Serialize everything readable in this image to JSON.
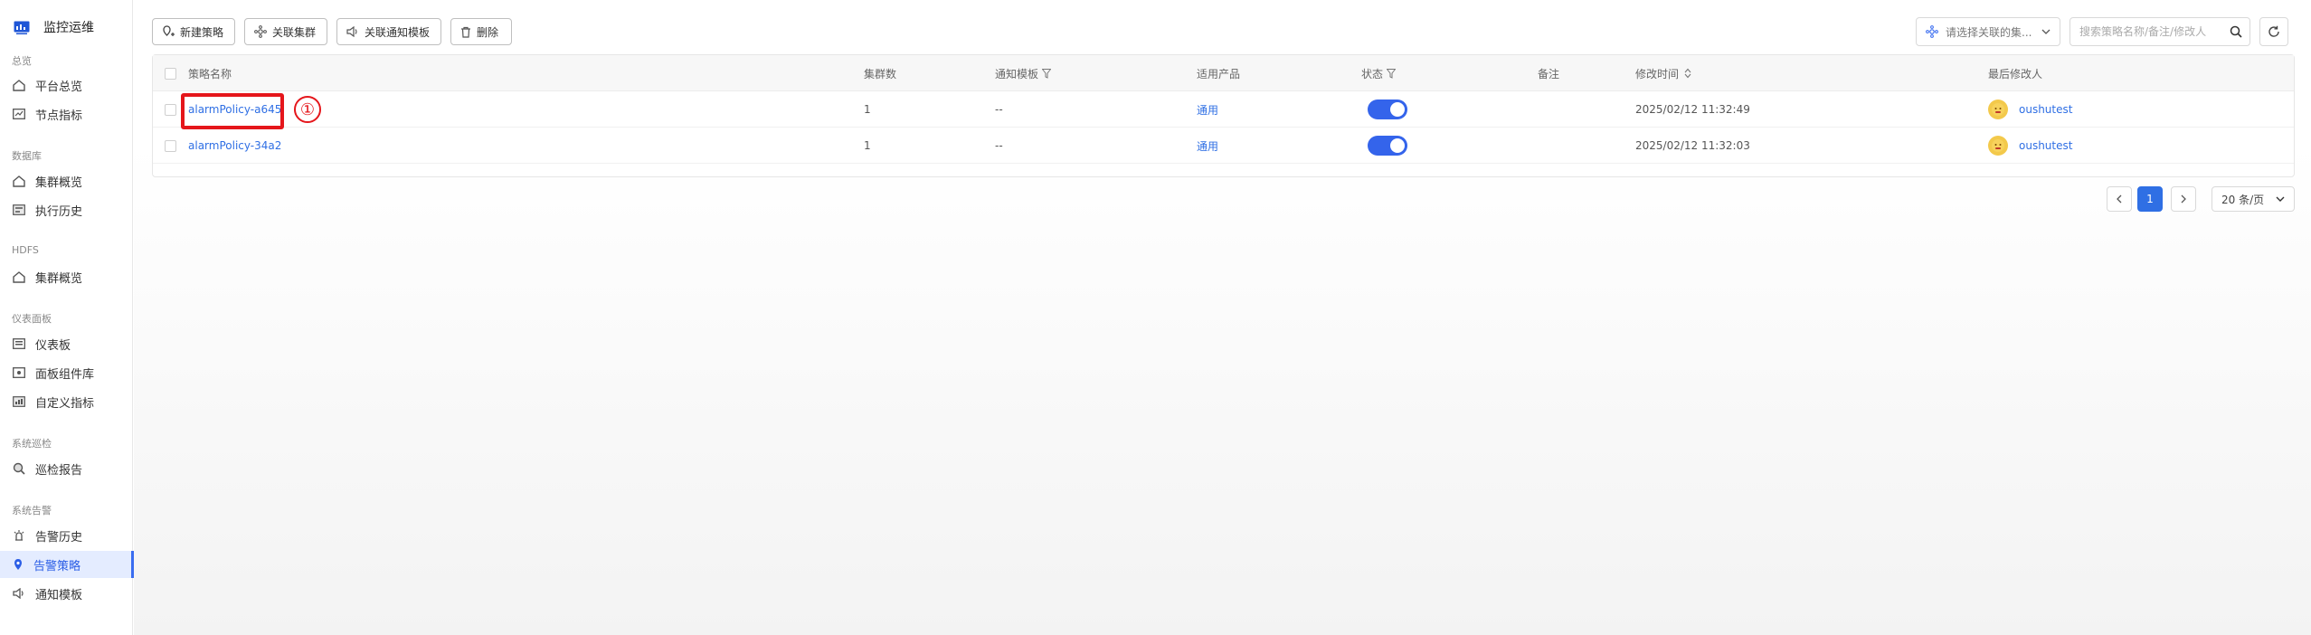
{
  "sidebar": {
    "app_title": "监控运维",
    "groups": [
      {
        "title": "总览",
        "items": [
          "平台总览",
          "节点指标"
        ]
      },
      {
        "title": "数据库",
        "items": [
          "集群概览",
          "执行历史"
        ]
      },
      {
        "title": "HDFS",
        "items": [
          "集群概览"
        ]
      },
      {
        "title": "仪表面板",
        "items": [
          "仪表板",
          "面板组件库",
          "自定义指标"
        ]
      },
      {
        "title": "系统巡检",
        "items": [
          "巡检报告"
        ]
      },
      {
        "title": "系统告警",
        "items": [
          "告警历史",
          "告警策略",
          "通知模板"
        ]
      }
    ],
    "active_item": "告警策略"
  },
  "toolbar": {
    "new_label": "新建策略",
    "link_cluster_label": "关联集群",
    "link_template_label": "关联通知模板",
    "delete_label": "删除",
    "cluster_select_placeholder": "请选择关联的集...",
    "search_placeholder": "搜索策略名称/备注/修改人"
  },
  "table": {
    "headers": {
      "name": "策略名称",
      "clusters": "集群数",
      "template": "通知模板",
      "product": "适用产品",
      "status": "状态",
      "remark": "备注",
      "modified_time": "修改时间",
      "modifier": "最后修改人"
    },
    "rows": [
      {
        "name": "alarmPolicy-a645",
        "clusters": "1",
        "template": "--",
        "product": "通用",
        "status": true,
        "remark": "",
        "modified_time": "2025/02/12 11:32:49",
        "modifier": "oushutest"
      },
      {
        "name": "alarmPolicy-34a2",
        "clusters": "1",
        "template": "--",
        "product": "通用",
        "status": true,
        "remark": "",
        "modified_time": "2025/02/12 11:32:03",
        "modifier": "oushutest"
      }
    ]
  },
  "annotation": {
    "marker": "①"
  },
  "pagination": {
    "current_page": "1",
    "page_size": "20 条/页"
  },
  "colors": {
    "accent": "#2f6fe4",
    "toggle_on": "#3464eb",
    "highlight": "#e5161b",
    "active_nav_bg": "#e4ecff"
  }
}
